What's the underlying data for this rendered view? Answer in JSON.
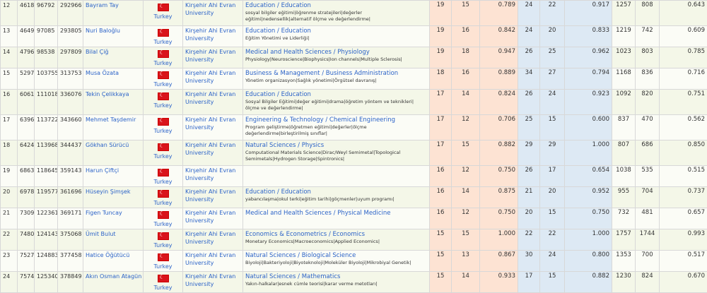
{
  "rows": [
    {
      "rank": "12",
      "c1": "4618",
      "c2": "96792",
      "c3": "292966",
      "name": "Bayram Tay",
      "country": "Turkey",
      "univ": "Kirşehir Ahi Evran University",
      "field": "Education / Education",
      "keywords": "sosyal bilgiler eğitimi|öğrenme stratejileri|değerler eğitimi|nedensellik|alternatif ölçme ve değerlendirme|",
      "n1": "19",
      "n2": "15",
      "r1": "0.789",
      "n3": "24",
      "n4": "22",
      "r2": "0.917",
      "n5": "1257",
      "n6": "808",
      "r3": "0.643"
    },
    {
      "rank": "13",
      "c1": "4649",
      "c2": "97085",
      "c3": "293805",
      "name": "Nuri Baloğlu",
      "country": "Turkey",
      "univ": "Kirşehir Ahi Evran University",
      "field": "Education / Education",
      "keywords": "Eğitim Yönetimi ve Liderliği|",
      "n1": "19",
      "n2": "16",
      "r1": "0.842",
      "n3": "24",
      "n4": "20",
      "r2": "0.833",
      "n5": "1219",
      "n6": "742",
      "r3": "0.609"
    },
    {
      "rank": "14",
      "c1": "4796",
      "c2": "98538",
      "c3": "297809",
      "name": "Bilal Çiğ",
      "country": "Turkey",
      "univ": "Kirşehir Ahi Evran University",
      "field": "Medical and Health Sciences / Physiology",
      "keywords": "Physiology|Neuroscience|Biophysics|Ion channels|Multiple Sclerosis|",
      "n1": "19",
      "n2": "18",
      "r1": "0.947",
      "n3": "26",
      "n4": "25",
      "r2": "0.962",
      "n5": "1023",
      "n6": "803",
      "r3": "0.785"
    },
    {
      "rank": "15",
      "c1": "5297",
      "c2": "103755",
      "c3": "313753",
      "name": "Musa Özata",
      "country": "Turkey",
      "univ": "Kirşehir Ahi Evran University",
      "field": "Business & Management / Business Administration",
      "keywords": "Yönetim organizasyon|Sağlık yönetimi|Örgütsel davranış|",
      "n1": "18",
      "n2": "16",
      "r1": "0.889",
      "n3": "34",
      "n4": "27",
      "r2": "0.794",
      "n5": "1168",
      "n6": "836",
      "r3": "0.716"
    },
    {
      "rank": "16",
      "c1": "6061",
      "c2": "111018",
      "c3": "336076",
      "name": "Tekin Çelikkaya",
      "country": "Turkey",
      "univ": "Kirşehir Ahi Evran University",
      "field": "Education / Education",
      "keywords": "Sosyal Bilgiler Eğitimi|değer eğitimi|drama|öğretim yöntem ve teknikleri|ölçme ve değerlendirme|",
      "n1": "17",
      "n2": "14",
      "r1": "0.824",
      "n3": "26",
      "n4": "24",
      "r2": "0.923",
      "n5": "1092",
      "n6": "820",
      "r3": "0.751"
    },
    {
      "rank": "17",
      "c1": "6396",
      "c2": "113722",
      "c3": "343660",
      "name": "Mehmet Taşdemir",
      "country": "Turkey",
      "univ": "Kirşehir Ahi Evran University",
      "field": "Engineering & Technology / Chemical Engineering",
      "keywords": "Program geliştirme|öğretmen eğitimi|değerler|ölçme değerlendirme|birleştirilmiş sınıflar|",
      "n1": "17",
      "n2": "12",
      "r1": "0.706",
      "n3": "25",
      "n4": "15",
      "r2": "0.600",
      "n5": "837",
      "n6": "470",
      "r3": "0.562"
    },
    {
      "rank": "18",
      "c1": "6424",
      "c2": "113968",
      "c3": "344437",
      "name": "Gökhan Sürücü",
      "country": "Turkey",
      "univ": "Kirşehir Ahi Evran University",
      "field": "Natural Sciences / Physics",
      "keywords": "Computational Materials Science|Dirac/Weyl Semimetal|Topological Semimetals|Hydrogen Storage|Spintronics|",
      "n1": "17",
      "n2": "15",
      "r1": "0.882",
      "n3": "29",
      "n4": "29",
      "r2": "1.000",
      "n5": "807",
      "n6": "686",
      "r3": "0.850"
    },
    {
      "rank": "19",
      "c1": "6863",
      "c2": "118645",
      "c3": "359143",
      "name": "Harun Çiftçi",
      "country": "Turkey",
      "univ": "Kirşehir Ahi Evran University",
      "field": "",
      "keywords": "",
      "n1": "16",
      "n2": "12",
      "r1": "0.750",
      "n3": "26",
      "n4": "17",
      "r2": "0.654",
      "n5": "1038",
      "n6": "535",
      "r3": "0.515"
    },
    {
      "rank": "20",
      "c1": "6978",
      "c2": "119577",
      "c3": "361696",
      "name": "Hüseyin Şimşek",
      "country": "Turkey",
      "univ": "Kirşehir Ahi Evran University",
      "field": "Education / Education",
      "keywords": "yabancılaşma|okul terki|eğitim tarihi|göçmenler|uyum programı|",
      "n1": "16",
      "n2": "14",
      "r1": "0.875",
      "n3": "21",
      "n4": "20",
      "r2": "0.952",
      "n5": "955",
      "n6": "704",
      "r3": "0.737"
    },
    {
      "rank": "21",
      "c1": "7309",
      "c2": "122361",
      "c3": "369171",
      "name": "Figen Tuncay",
      "country": "Turkey",
      "univ": "Kirşehir Ahi Evran University",
      "field": "Medical and Health Sciences / Physical Medicine",
      "keywords": "",
      "n1": "16",
      "n2": "12",
      "r1": "0.750",
      "n3": "20",
      "n4": "15",
      "r2": "0.750",
      "n5": "732",
      "n6": "481",
      "r3": "0.657"
    },
    {
      "rank": "22",
      "c1": "7480",
      "c2": "124143",
      "c3": "375068",
      "name": "Ümit Bulut",
      "country": "Turkey",
      "univ": "Kirşehir Ahi Evran University",
      "field": "Economics & Econometrics / Economics",
      "keywords": "Monetary Economics|Macroeconomics|Applied Economics|",
      "n1": "15",
      "n2": "15",
      "r1": "1.000",
      "n3": "22",
      "n4": "22",
      "r2": "1.000",
      "n5": "1757",
      "n6": "1744",
      "r3": "0.993"
    },
    {
      "rank": "23",
      "c1": "7527",
      "c2": "124883",
      "c3": "377458",
      "name": "Hatice Öğütücü",
      "country": "Turkey",
      "univ": "Kirşehir Ahi Evran University",
      "field": "Natural Sciences / Biological Science",
      "keywords": "Biyoloji|Bakteriyoloji|Biyoteknoloji|Moleküler Biyoloji|Mikrobiyal Genetik|",
      "n1": "15",
      "n2": "13",
      "r1": "0.867",
      "n3": "30",
      "n4": "24",
      "r2": "0.800",
      "n5": "1353",
      "n6": "700",
      "r3": "0.517"
    },
    {
      "rank": "24",
      "c1": "7574",
      "c2": "125340",
      "c3": "378849",
      "name": "Akın Osman Atagün",
      "country": "Turkey",
      "univ": "Kirşehir Ahi Evran University",
      "field": "Natural Sciences / Mathematics",
      "keywords": "Yakın-halkalar|esnek cümle teorisi|karar verme metotları|",
      "n1": "15",
      "n2": "14",
      "r1": "0.933",
      "n3": "17",
      "n4": "15",
      "r2": "0.882",
      "n5": "1230",
      "n6": "824",
      "r3": "0.670"
    }
  ]
}
